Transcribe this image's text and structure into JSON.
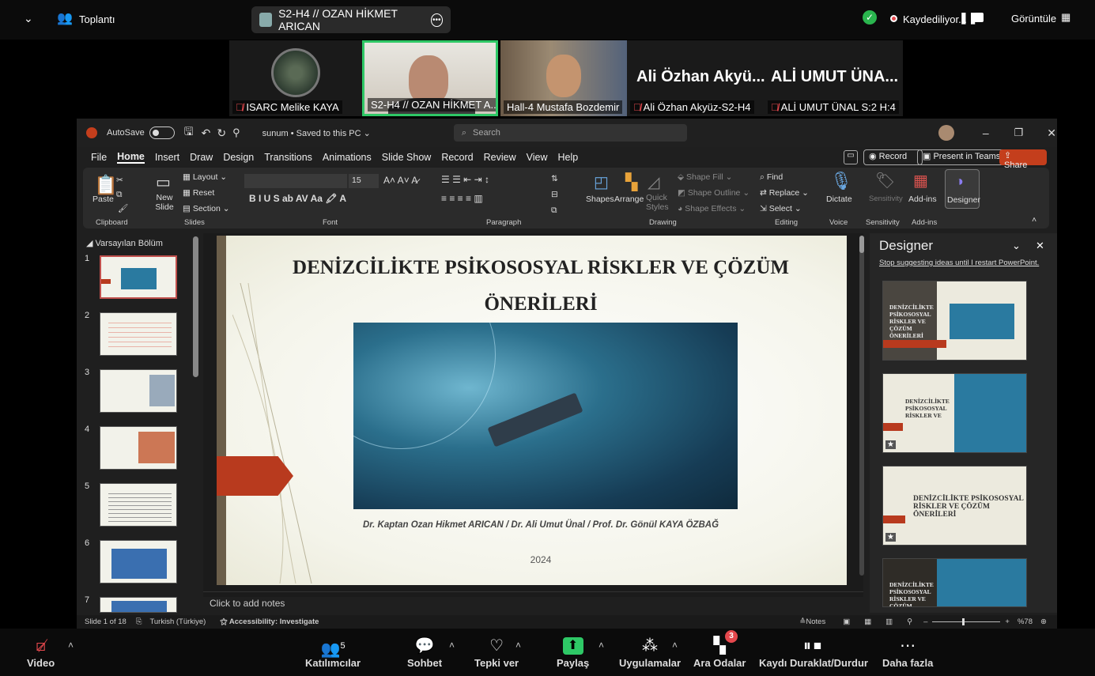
{
  "topbar": {
    "meeting_label": "Toplantı",
    "share_title": "S2-H4 // OZAN HİKMET ARICAN",
    "recording": "Kaydediliyor...",
    "view": "Görüntüle"
  },
  "participants": [
    {
      "name": "ISARC Melike KAYA",
      "muted": true
    },
    {
      "name": "S2-H4 // OZAN HİKMET A...",
      "muted": false
    },
    {
      "name": "Hall-4  Mustafa Bozdemir",
      "muted": false
    },
    {
      "big": "Ali  Özhan Akyü...",
      "name": "Ali  Özhan Akyüz-S2-H4",
      "muted": true
    },
    {
      "big": "ALİ UMUT ÜNA...",
      "name": "ALİ UMUT ÜNAL S:2 H:4",
      "muted": true
    }
  ],
  "ppt": {
    "autosave": "AutoSave",
    "file_title": "sunum • Saved to this PC ⌄",
    "search": "Search",
    "menu": [
      "File",
      "Home",
      "Insert",
      "Draw",
      "Design",
      "Transitions",
      "Animations",
      "Slide Show",
      "Record",
      "Review",
      "View",
      "Help"
    ],
    "record_btn": "Record",
    "present_btn": "Present in Teams",
    "share_btn": "Share",
    "ribbon": {
      "paste": "Paste",
      "clipboard": "Clipboard",
      "new_slide": "New Slide",
      "layout": "Layout",
      "reset": "Reset",
      "section": "Section",
      "slides": "Slides",
      "font_size": "15",
      "font": "Font",
      "paragraph": "Paragraph",
      "shapes": "Shapes",
      "arrange": "Arrange",
      "quick_styles": "Quick Styles",
      "shape_fill": "Shape Fill",
      "shape_outline": "Shape Outline",
      "shape_effects": "Shape Effects",
      "drawing": "Drawing",
      "find": "Find",
      "replace": "Replace",
      "select": "Select",
      "editing": "Editing",
      "dictate": "Dictate",
      "voice": "Voice",
      "sensitivity": "Sensitivity",
      "addins": "Add-ins",
      "designer": "Designer"
    },
    "section_name": "Varsayılan Bölüm",
    "slide_numbers": [
      "1",
      "2",
      "3",
      "4",
      "5",
      "6",
      "7"
    ],
    "slide": {
      "title": "DENİZCİLİKTE PSİKOSOSYAL RİSKLER VE ÇÖZÜM ÖNERİLERİ",
      "authors": "Dr. Kaptan Ozan Hikmet ARICAN / Dr. Ali Umut Ünal / Prof. Dr. Gönül KAYA ÖZBAĞ",
      "year": "2024"
    },
    "notes_placeholder": "Click to add notes",
    "designer": {
      "title": "Designer",
      "link": "Stop suggesting ideas until I restart PowerPoint.",
      "card1": "DENİZCİLİKTE PSİKOSOSYAL RİSKLER VE ÇÖZÜM ÖNERİLERİ",
      "card2": "DENİZCİLİKTE PSİKOSOSYAL RİSKLER VE",
      "card3": "DENİZCİLİKTE PSİKOSOSYAL RİSKLER VE ÇÖZÜM ÖNERİLERİ",
      "card4": "DENİZCİLİKTE PSİKOSOSYAL RİSKLER VE ÇÖZÜM"
    },
    "status": {
      "slide": "Slide 1 of 18",
      "lang": "Turkish (Türkiye)",
      "access": "Accessibility: Investigate",
      "notes": "Notes",
      "zoom": "%78"
    }
  },
  "bottombar": {
    "video": "Video",
    "participants": "Katılımcılar",
    "participants_count": "5",
    "chat": "Sohbet",
    "react": "Tepki ver",
    "share": "Paylaş",
    "apps": "Uygulamalar",
    "breakout": "Ara Odalar",
    "breakout_badge": "3",
    "pause_rec": "Kaydı Duraklat/Durdur",
    "more": "Daha fazla"
  }
}
